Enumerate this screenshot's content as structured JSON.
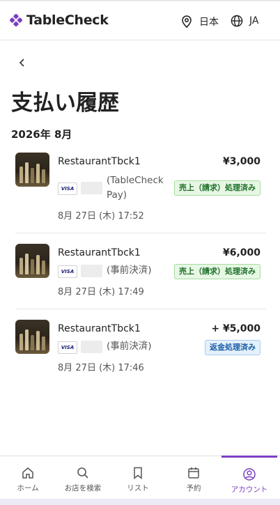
{
  "header": {
    "brand": "TableCheck",
    "region": "日本",
    "language": "JA"
  },
  "page": {
    "title": "支払い履歴",
    "month": "2026年 8月"
  },
  "payments": [
    {
      "restaurant": "RestaurantTbck1",
      "amount": "¥3,000",
      "card_brand": "VISA",
      "method_line1": "(TableCheck",
      "method_line2": "Pay)",
      "status": "売上（請求）処理済み",
      "date": "8月 27日 (木) 17:52"
    },
    {
      "restaurant": "RestaurantTbck1",
      "amount": "¥6,000",
      "card_brand": "VISA",
      "method_line1": "(事前決済)",
      "status": "売上（請求）処理済み",
      "date": "8月 27日 (木) 17:49"
    },
    {
      "restaurant": "RestaurantTbck1",
      "amount": "+ ¥5,000",
      "card_brand": "VISA",
      "method_line1": "(事前決済)",
      "status": "返金処理済み",
      "date": "8月 27日 (木) 17:46"
    }
  ],
  "tabs": [
    {
      "label": "ホーム",
      "icon": "home-icon"
    },
    {
      "label": "お店を検索",
      "icon": "search-icon"
    },
    {
      "label": "リスト",
      "icon": "bookmark-icon"
    },
    {
      "label": "予約",
      "icon": "calendar-icon"
    },
    {
      "label": "アカウント",
      "icon": "account-icon",
      "active": true
    }
  ],
  "colors": {
    "accent": "#7b3fc4",
    "status_charged": "#1d6f2a",
    "status_refunded": "#1a5fa8"
  }
}
